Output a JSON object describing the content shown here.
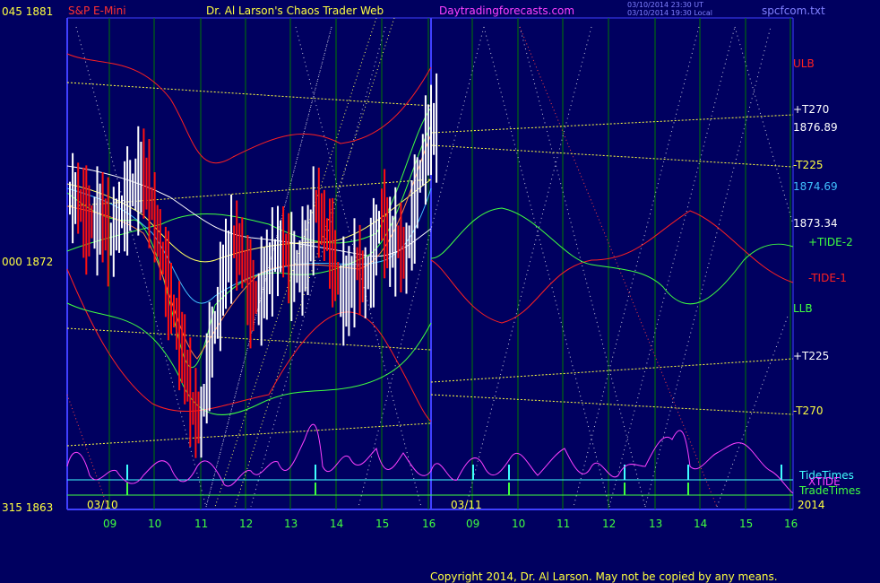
{
  "header": {
    "left_price_label": "045  1881",
    "symbol": "S&P E-Mini",
    "site_title": "Dr. Al Larson's Chaos Trader Web",
    "site_url": "Daytradingforecasts.com",
    "timestamp_line1": "03/10/2014 23:30 UT",
    "timestamp_line2": "03/10/2014 19:30 Local",
    "filename": "spcfcom.txt",
    "colors": {
      "symbol": "#ff3030",
      "title": "#ffff40",
      "url": "#ff40ff",
      "timestamp": "#8080ff",
      "filename": "#8080ff"
    }
  },
  "left_axis": {
    "mid_label": "000  1872",
    "bottom_label": "315  1863"
  },
  "right_labels": [
    {
      "text": "ULB",
      "color": "#ff2020"
    },
    {
      "text": "+T270",
      "color": "#ffffff"
    },
    {
      "text": "1876.89",
      "color": "#ffffff"
    },
    {
      "text": "-T225",
      "color": "#ffff40"
    },
    {
      "text": "1874.69",
      "color": "#40c0ff"
    },
    {
      "text": "1873.34",
      "color": "#ffffff"
    },
    {
      "text": "+TIDE-2",
      "color": "#40ff40"
    },
    {
      "text": "-TIDE-1",
      "color": "#ff2020"
    },
    {
      "text": "LLB",
      "color": "#40ff40"
    },
    {
      "text": "+T225",
      "color": "#ffffff"
    },
    {
      "text": "-T270",
      "color": "#ffff40"
    },
    {
      "text": "TideTimes",
      "color": "#40ffff"
    },
    {
      "text": "XTIDE",
      "color": "#ff40ff"
    },
    {
      "text": "TradeTimes",
      "color": "#40ff40"
    }
  ],
  "x_axis": {
    "hour_ticks": [
      "09",
      "10",
      "11",
      "12",
      "13",
      "14",
      "15",
      "16",
      "09",
      "10",
      "11",
      "12",
      "13",
      "14",
      "15",
      "16"
    ],
    "date_labels": [
      "03/10",
      "03/11"
    ],
    "year_label": "2014"
  },
  "footer": {
    "copyright": "Copyright 2014, Dr. Al Larson. May not be copied by any means."
  },
  "chart_data": {
    "type": "line",
    "title": "S&P E-Mini",
    "y_axis": {
      "ylim": [
        1863,
        1881
      ],
      "tick_labels": [
        "1881",
        "1872",
        "1863"
      ]
    },
    "x_axis": {
      "categories": [
        "09",
        "10",
        "11",
        "12",
        "13",
        "14",
        "15",
        "16",
        "09",
        "10",
        "11",
        "12",
        "13",
        "14",
        "15",
        "16"
      ]
    },
    "price_levels": {
      "1876.89": 1876.89,
      "1874.69": 1874.69,
      "1873.34": 1873.34
    },
    "series": [
      {
        "name": "ULB",
        "color": "#ff2020"
      },
      {
        "name": "+TIDE-2",
        "color": "#40ff40"
      },
      {
        "name": "-TIDE-1",
        "color": "#ff2020"
      },
      {
        "name": "LLB",
        "color": "#40ff40"
      },
      {
        "name": "XTIDE",
        "color": "#ff40ff"
      },
      {
        "name": "TideTimes",
        "color": "#40ffff"
      },
      {
        "name": "TradeTimes",
        "color": "#40ff40"
      }
    ],
    "price_path": [
      1874.4,
      1873.6,
      1873.5,
      1873.7,
      1872.9,
      1873.7,
      1874.3,
      1874.9,
      1875.3,
      1874.2,
      1872.7,
      1871.2,
      1869.8,
      1868.5,
      1866.7,
      1866.2,
      1868.6,
      1870.2,
      1872.0,
      1872.8,
      1872.4,
      1870.9,
      1870.7,
      1871.6,
      1872.3,
      1872.8,
      1871.9,
      1871.9,
      1872.5,
      1874.1,
      1873.4,
      1872.4,
      1871.0,
      1871.0,
      1872.0,
      1871.3,
      1872.4,
      1873.8,
      1872.8,
      1872.8,
      1872.2,
      1874.0,
      1875.8,
      1876.9,
      1877.0
    ]
  }
}
